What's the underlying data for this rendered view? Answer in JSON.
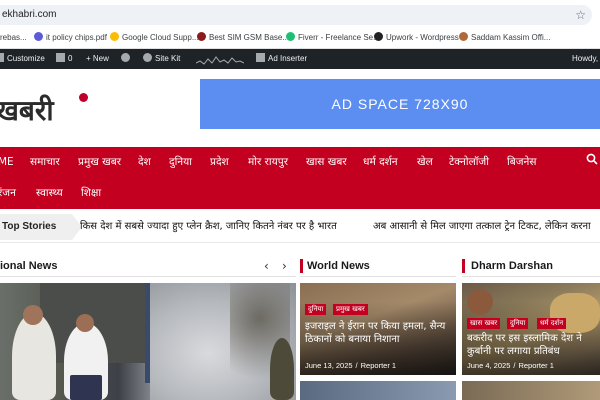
{
  "browser": {
    "url": "ekhabri.com"
  },
  "bookmarks": [
    {
      "label": "rebas...",
      "color": "#4285f4"
    },
    {
      "label": "it policy chips.pdf",
      "color": "#5b5bd6"
    },
    {
      "label": "Google Cloud Supp...",
      "color": "#fbbc05"
    },
    {
      "label": "Best SIM GSM Base...",
      "color": "#8b1a1a"
    },
    {
      "label": "Fiverr - Freelance Se...",
      "color": "#1dbf73"
    },
    {
      "label": "Upwork - Wordpress",
      "color": "#222222"
    },
    {
      "label": "Saddam Kassim Offi...",
      "color": "#b06a3a"
    }
  ],
  "admin_bar": {
    "customize": "Customize",
    "comments": "0",
    "new": "New",
    "site_kit": "Site Kit",
    "ad_inserter": "Ad Inserter",
    "howdy": "Howdy,"
  },
  "header": {
    "logo": "खबरी",
    "ad_label": "AD SPACE 728X90"
  },
  "nav": {
    "row1": [
      "ME",
      "समाचार",
      "प्रमुख खबर",
      "देश",
      "दुनिया",
      "प्रदेश",
      "मोर रायपुर",
      "खास खबर",
      "धर्म दर्शन",
      "खेल",
      "टेक्नोलॉजी",
      "बिजनेस"
    ],
    "row2": [
      "रंजन",
      "स्वास्थ्य",
      "शिक्षा"
    ]
  },
  "top_stories": {
    "label": "Top Stories",
    "items": [
      "किस देश में सबसे ज्यादा हुए प्लेन क्रैश, जानिए कितने नंबर पर है भारत",
      "अब आसानी से मिल जाएगा तत्काल ट्रेन टिकट, लेकिन करना"
    ]
  },
  "sections": {
    "national": {
      "title": "ional News",
      "prev": "‹",
      "next": "›"
    },
    "world": {
      "title": "World News"
    },
    "dharm": {
      "title": "Dharm Darshan"
    }
  },
  "cards": {
    "world": {
      "tags": [
        "दुनिया",
        "प्रमुख खबर"
      ],
      "title": "इजराइल ने ईरान पर किया हमला, सैन्य ठिकानों को बनाया निशाना",
      "date": "June 13, 2025",
      "author": "Reporter 1"
    },
    "dharm": {
      "tags": [
        "खास खबर",
        "दुनिया",
        "धर्म दर्शन"
      ],
      "title": "बकरीद पर इस इस्लामिक देश ने कुर्बानी पर लगाया प्रतिबंध",
      "date": "June 4, 2025",
      "author": "Reporter 1"
    }
  },
  "colors": {
    "brand_red": "#c3001f",
    "ad_blue": "#5b8ef0",
    "admin_bar": "#1d2327"
  }
}
